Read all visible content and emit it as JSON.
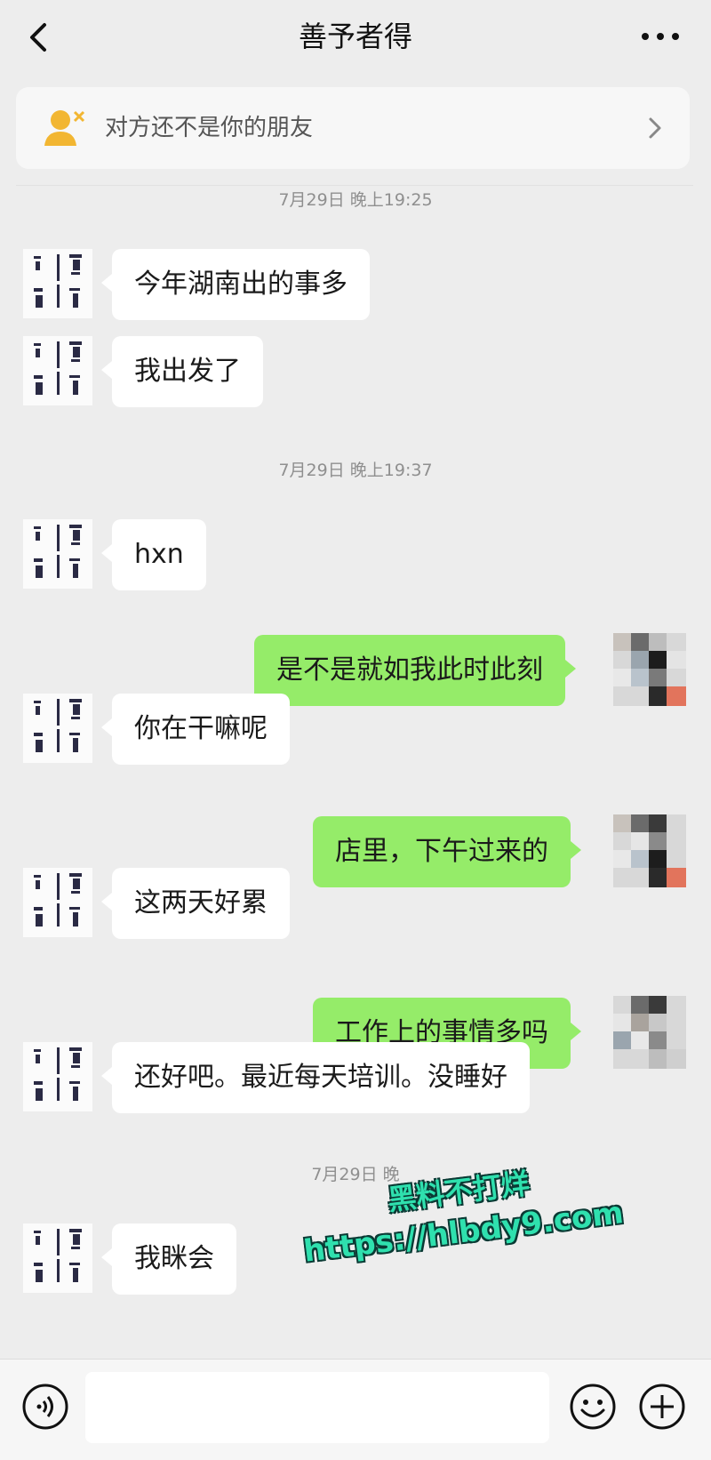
{
  "header": {
    "title": "善予者得",
    "back_icon": "chevron-left-icon",
    "more_icon": "more-icon"
  },
  "banner": {
    "text": "对方还不是你的朋友",
    "icon": "stranger-user-icon",
    "arrow_icon": "chevron-right-icon"
  },
  "messages": {
    "ts1": "7月29日 晚上19:25",
    "m1": "今年湖南出的事多",
    "m2": "我出发了",
    "ts2": "7月29日 晚上19:37",
    "m3": "hxn",
    "m4": "是不是就如我此时此刻",
    "m5": "你在干嘛呢",
    "m6": "店里，下午过来的",
    "m7": "这两天好累",
    "m8": "工作上的事情多吗",
    "m9": "还好吧。最近每天培训。没睡好",
    "ts3": "7月29日 晚",
    "m10": "我眯会"
  },
  "watermark": {
    "line1": "黑料不打烊",
    "line2": "https://hlbdy9.com"
  },
  "input": {
    "placeholder": ""
  },
  "colors": {
    "background": "#ededed",
    "outgoing_bubble": "#95ec69",
    "incoming_bubble": "#ffffff",
    "watermark": "#2fe0ae"
  }
}
